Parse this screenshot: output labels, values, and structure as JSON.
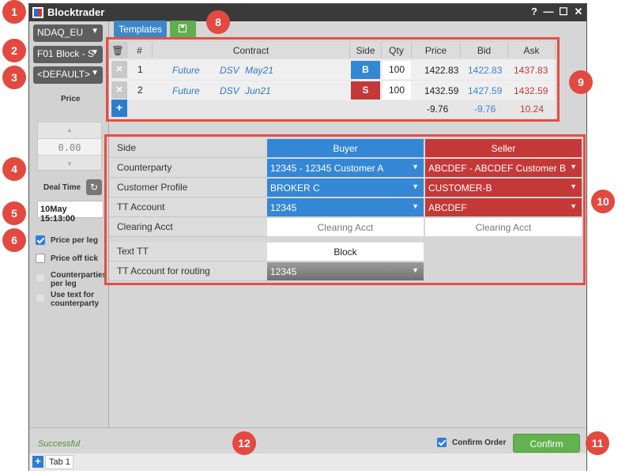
{
  "app": {
    "title": "Blocktrader"
  },
  "window_controls": {
    "help": "?",
    "minimize": "—",
    "maximize": "☐",
    "close": "✕"
  },
  "left_panel": {
    "exchange_value": "NDAQ_EU",
    "block_type_value": "F01 Block - S",
    "account_value": "<DEFAULT>",
    "price_label": "Price",
    "price_value": "0.00",
    "deal_time_label": "Deal Time",
    "deal_time_value": "10May 15:13:00",
    "options": [
      {
        "label": "Price per leg",
        "checked": true,
        "enabled": true
      },
      {
        "label": "Price off tick",
        "checked": false,
        "enabled": true
      },
      {
        "label": "Counterparties per leg",
        "checked": false,
        "enabled": false
      },
      {
        "label": "Use text for counterparty",
        "checked": false,
        "enabled": false
      }
    ]
  },
  "toolbar": {
    "templates_label": "Templates"
  },
  "legs_table": {
    "headers": {
      "num": "#",
      "contract": "Contract",
      "side": "Side",
      "qty": "Qty",
      "price": "Price",
      "bid": "Bid",
      "ask": "Ask"
    },
    "rows": [
      {
        "num": "1",
        "type": "Future",
        "product": "DSV",
        "expiry": "May21",
        "side": "B",
        "qty": "100",
        "price": "1422.83",
        "bid": "1422.83",
        "ask": "1437.83"
      },
      {
        "num": "2",
        "type": "Future",
        "product": "DSV",
        "expiry": "Jun21",
        "side": "S",
        "qty": "100",
        "price": "1432.59",
        "bid": "1427.59",
        "ask": "1432.59"
      }
    ],
    "totals": {
      "price": "-9.76",
      "bid": "-9.76",
      "ask": "10.24"
    }
  },
  "properties": {
    "side": {
      "label": "Side",
      "buyer": "Buyer",
      "seller": "Seller"
    },
    "counterparty": {
      "label": "Counterparty",
      "buyer": "12345 - 12345 Customer A",
      "seller": "ABCDEF - ABCDEF Customer B"
    },
    "customer_profile": {
      "label": "Customer Profile",
      "buyer": "BROKER C",
      "seller": "CUSTOMER-B"
    },
    "tt_account": {
      "label": "TT Account",
      "buyer": "12345",
      "seller": "ABCDEF"
    },
    "clearing_acct": {
      "label": "Clearing Acct",
      "buyer_placeholder": "Clearing Acct",
      "seller_placeholder": "Clearing Acct"
    },
    "text_tt": {
      "label": "Text TT",
      "value": "Block"
    },
    "tt_account_routing": {
      "label": "TT Account for routing",
      "value": "12345"
    }
  },
  "status": {
    "message": "Successful",
    "confirm_order_label": "Confirm Order",
    "confirm_order_checked": true,
    "confirm_label": "Confirm"
  },
  "tabs": [
    {
      "label": "Tab 1"
    }
  ],
  "callouts": [
    "1",
    "2",
    "3",
    "4",
    "5",
    "6",
    "8",
    "9",
    "10",
    "11",
    "12"
  ],
  "colors": {
    "buy": "#3487d4",
    "sell": "#c43838",
    "callout": "#e2493f",
    "confirm": "#63b24f"
  }
}
